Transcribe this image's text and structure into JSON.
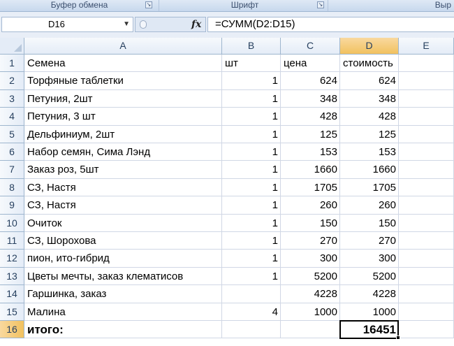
{
  "ribbon": {
    "groups": [
      {
        "label": "Буфер обмена"
      },
      {
        "label": "Шрифт"
      },
      {
        "label": "Выр"
      }
    ]
  },
  "formula_bar": {
    "name_box": "D16",
    "fx_label": "fx",
    "formula": "=СУММ(D2:D15)"
  },
  "columns": [
    "A",
    "B",
    "C",
    "D",
    "E"
  ],
  "active_column": "D",
  "active_row": 16,
  "rows": [
    {
      "n": "1",
      "a": "Семена",
      "b": "шт",
      "c": "цена",
      "d": "стоимость"
    },
    {
      "n": "2",
      "a": "Торфяные таблетки",
      "b": "1",
      "c": "624",
      "d": "624"
    },
    {
      "n": "3",
      "a": "Петуния, 2шт",
      "b": "1",
      "c": "348",
      "d": "348"
    },
    {
      "n": "4",
      "a": "Петуния, 3 шт",
      "b": "1",
      "c": "428",
      "d": "428"
    },
    {
      "n": "5",
      "a": "Дельфиниум, 2шт",
      "b": "1",
      "c": "125",
      "d": "125"
    },
    {
      "n": "6",
      "a": "Набор семян, Сима Лэнд",
      "b": "1",
      "c": "153",
      "d": "153"
    },
    {
      "n": "7",
      "a": "Заказ роз, 5шт",
      "b": "1",
      "c": "1660",
      "d": "1660"
    },
    {
      "n": "8",
      "a": "СЗ, Настя",
      "b": "1",
      "c": "1705",
      "d": "1705"
    },
    {
      "n": "9",
      "a": "СЗ, Настя",
      "b": "1",
      "c": "260",
      "d": "260"
    },
    {
      "n": "10",
      "a": "Очиток",
      "b": "1",
      "c": "150",
      "d": "150"
    },
    {
      "n": "11",
      "a": "СЗ, Шорохова",
      "b": "1",
      "c": "270",
      "d": "270"
    },
    {
      "n": "12",
      "a": "пион, ито-гибрид",
      "b": "1",
      "c": "300",
      "d": "300"
    },
    {
      "n": "13",
      "a": "Цветы мечты, заказ клематисов",
      "b": "1",
      "c": "5200",
      "d": "5200"
    },
    {
      "n": "14",
      "a": "Гаршинка, заказ",
      "b": "",
      "c": "4228",
      "d": "4228"
    },
    {
      "n": "15",
      "a": "Малина",
      "b": "4",
      "c": "1000",
      "d": "1000"
    },
    {
      "n": "16",
      "a": "итого:",
      "b": "",
      "c": "",
      "d": "16451"
    }
  ]
}
